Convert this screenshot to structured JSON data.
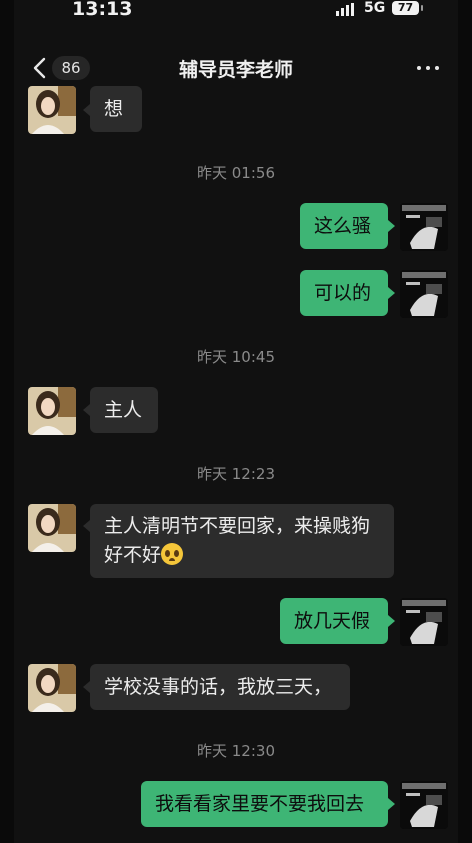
{
  "status_bar": {
    "time": "13:13",
    "network": "5G",
    "battery": "77"
  },
  "nav": {
    "unread_count": "86",
    "title": "辅导员李老师"
  },
  "messages": [
    {
      "side": "in",
      "text": "想"
    },
    {
      "type": "time",
      "text": "昨天 01:56"
    },
    {
      "side": "out",
      "text": "这么骚"
    },
    {
      "side": "out",
      "text": "可以的"
    },
    {
      "type": "time",
      "text": "昨天 10:45"
    },
    {
      "side": "in",
      "text": "主人"
    },
    {
      "type": "time",
      "text": "昨天 12:23"
    },
    {
      "side": "in",
      "line1": "主人清明节不要回家，来操贱狗",
      "line2": "好不好",
      "emoji": "pleading-face"
    },
    {
      "side": "out",
      "text": "放几天假"
    },
    {
      "side": "in",
      "text": "学校没事的话，我放三天，"
    },
    {
      "type": "time",
      "text": "昨天 12:30"
    },
    {
      "side": "out",
      "text": "我看看家里要不要我回去"
    }
  ],
  "colors": {
    "bubble_out": "#3eb575",
    "bubble_in": "#2c2c2c",
    "background": "#111111"
  }
}
